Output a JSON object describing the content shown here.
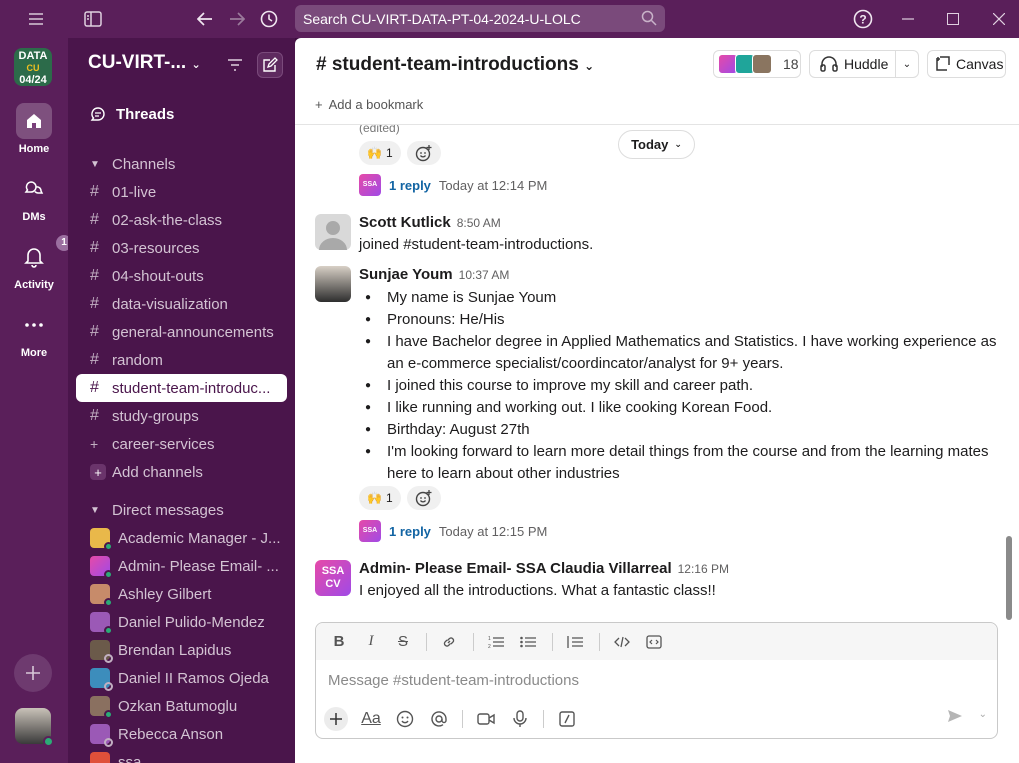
{
  "titlebar": {
    "search_text": "Search CU-VIRT-DATA-PT-04-2024-U-LOLC"
  },
  "rail": {
    "workspace_line1": "DATA",
    "workspace_line2": "CU",
    "workspace_line3": "04/24",
    "items": [
      {
        "label": "Home"
      },
      {
        "label": "DMs"
      },
      {
        "label": "Activity",
        "badge": "1"
      },
      {
        "label": "More"
      }
    ]
  },
  "sidebar": {
    "workspace_name": "CU-VIRT-...",
    "threads_label": "Threads",
    "channels_header": "Channels",
    "channels": [
      "01-live",
      "02-ask-the-class",
      "03-resources",
      "04-shout-outs",
      "data-visualization",
      "general-announcements",
      "random",
      "student-team-introduc...",
      "study-groups",
      "career-services"
    ],
    "add_channels": "Add channels",
    "dm_header": "Direct messages",
    "dms": [
      "Academic Manager - J...",
      "Admin- Please Email- ...",
      "Ashley Gilbert",
      "Daniel Pulido-Mendez",
      "Brendan Lapidus",
      "Daniel II Ramos Ojeda",
      "Ozkan Batumoglu",
      "Rebecca Anson",
      "ssa"
    ]
  },
  "channel": {
    "title": "# student-team-introductions",
    "member_count": "18",
    "huddle_label": "Huddle",
    "canvas_label": "Canvas",
    "add_bookmark": "Add a bookmark",
    "today_label": "Today"
  },
  "messages": {
    "edited": "(edited)",
    "react1_emoji": "🙌",
    "react1_count": "1",
    "thread1_reply": "1 reply",
    "thread1_time": "Today at 12:14 PM",
    "scott_name": "Scott Kutlick",
    "scott_time": "8:50 AM",
    "scott_text": "joined #student-team-introductions.",
    "sunjae_name": "Sunjae Youm",
    "sunjae_time": "10:37 AM",
    "sunjae_bullets": [
      "My name is Sunjae Youm",
      "Pronouns: He/His",
      "I have Bachelor degree in Applied Mathematics and Statistics. I have working experience as an e-commerce specialist/coordincator/analyst for 9+ years.",
      "I joined this course to improve my skill and career path.",
      "I like running and working out. I like cooking Korean Food.",
      "Birthday: August 27th",
      "I'm looking forward to learn more detail things from the course and from the learning mates here to learn about other industries"
    ],
    "react2_emoji": "🙌",
    "react2_count": "1",
    "thread2_reply": "1 reply",
    "thread2_time": "Today at 12:15 PM",
    "admin_name": "Admin- Please Email- SSA Claudia Villarreal",
    "admin_time": "12:16 PM",
    "admin_text": "I enjoyed all the introductions. What a fantastic class!!",
    "ssa_avatar_text": "SSA CV"
  },
  "composer": {
    "placeholder": "Message #student-team-introductions"
  },
  "colors": {
    "aubergine": "#4a154b",
    "rail": "#5a1f5a",
    "link": "#1264a3",
    "online": "#2bac76"
  }
}
